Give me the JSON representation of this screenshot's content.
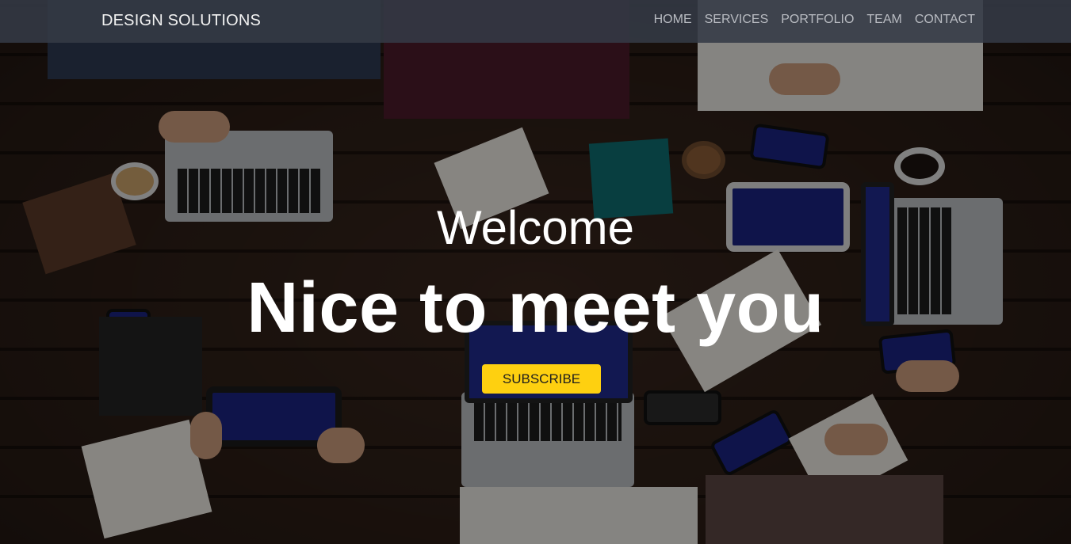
{
  "nav": {
    "brand": "DESIGN SOLUTIONS",
    "links": [
      "HOME",
      "SERVICES",
      "PORTFOLIO",
      "TEAM",
      "CONTACT"
    ]
  },
  "hero": {
    "welcome": "Welcome",
    "headline": "Nice to meet you",
    "cta_label": "SUBSCRIBE"
  },
  "colors": {
    "navbar_bg": "#343a46",
    "cta_bg": "#fed010",
    "text": "#ffffff"
  },
  "background": {
    "description_icon": "team-meeting-photo"
  }
}
